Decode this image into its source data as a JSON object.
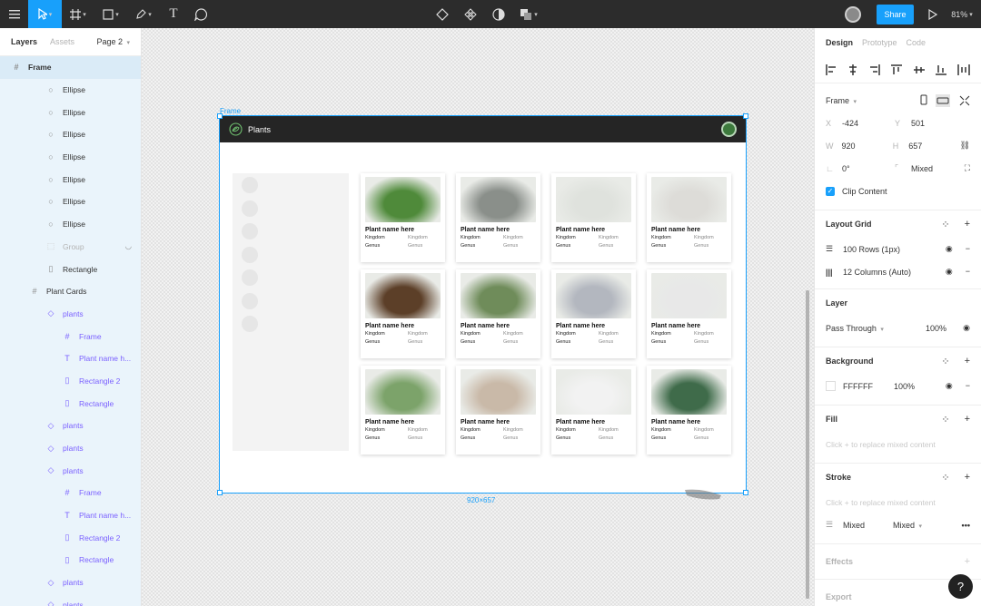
{
  "topbar": {
    "share_label": "Share",
    "zoom": "81%"
  },
  "left_panel": {
    "tabs": [
      "Layers",
      "Assets"
    ],
    "page": "Page 2",
    "layers": [
      {
        "label": "Frame",
        "icon": "frame-icon",
        "indent": 0,
        "kind": "selected"
      },
      {
        "label": "Ellipse",
        "icon": "ellipse-icon",
        "indent": 2,
        "kind": "sub"
      },
      {
        "label": "Ellipse",
        "icon": "ellipse-icon",
        "indent": 2,
        "kind": "sub"
      },
      {
        "label": "Ellipse",
        "icon": "ellipse-icon",
        "indent": 2,
        "kind": "sub"
      },
      {
        "label": "Ellipse",
        "icon": "ellipse-icon",
        "indent": 2,
        "kind": "sub"
      },
      {
        "label": "Ellipse",
        "icon": "ellipse-icon",
        "indent": 2,
        "kind": "sub"
      },
      {
        "label": "Ellipse",
        "icon": "ellipse-icon",
        "indent": 2,
        "kind": "sub"
      },
      {
        "label": "Ellipse",
        "icon": "ellipse-icon",
        "indent": 2,
        "kind": "sub"
      },
      {
        "label": "Group",
        "icon": "group-icon",
        "indent": 2,
        "kind": "hidden"
      },
      {
        "label": "Rectangle",
        "icon": "rectangle-icon",
        "indent": 2,
        "kind": "sub"
      },
      {
        "label": "Plant Cards",
        "icon": "frame-icon",
        "indent": 1,
        "kind": "sub"
      },
      {
        "label": "plants",
        "icon": "instance-icon",
        "indent": 2,
        "kind": "component"
      },
      {
        "label": "Frame",
        "icon": "frame-icon",
        "indent": 3,
        "kind": "component"
      },
      {
        "label": "Plant name h...",
        "icon": "text-icon",
        "indent": 3,
        "kind": "component"
      },
      {
        "label": "Rectangle 2",
        "icon": "rectangle-icon",
        "indent": 3,
        "kind": "component"
      },
      {
        "label": "Rectangle",
        "icon": "rectangle-icon",
        "indent": 3,
        "kind": "component"
      },
      {
        "label": "plants",
        "icon": "instance-icon",
        "indent": 2,
        "kind": "component"
      },
      {
        "label": "plants",
        "icon": "instance-icon",
        "indent": 2,
        "kind": "component"
      },
      {
        "label": "plants",
        "icon": "instance-icon",
        "indent": 2,
        "kind": "component"
      },
      {
        "label": "Frame",
        "icon": "frame-icon",
        "indent": 3,
        "kind": "component"
      },
      {
        "label": "Plant name h...",
        "icon": "text-icon",
        "indent": 3,
        "kind": "component"
      },
      {
        "label": "Rectangle 2",
        "icon": "rectangle-icon",
        "indent": 3,
        "kind": "component"
      },
      {
        "label": "Rectangle",
        "icon": "rectangle-icon",
        "indent": 3,
        "kind": "component"
      },
      {
        "label": "plants",
        "icon": "instance-icon",
        "indent": 2,
        "kind": "component"
      },
      {
        "label": "plants",
        "icon": "instance-icon",
        "indent": 2,
        "kind": "component"
      }
    ]
  },
  "canvas": {
    "frame_label": "Frame",
    "size_label": "920×657",
    "app_title": "Plants",
    "cards": [
      {
        "name": "Plant name here",
        "k1": "Kingdom",
        "k2": "Kingdom",
        "g1": "Genus",
        "g2": "Genus"
      },
      {
        "name": "Plant name here",
        "k1": "Kingdom",
        "k2": "Kingdom",
        "g1": "Genus",
        "g2": "Genus"
      },
      {
        "name": "Plant name here",
        "k1": "Kingdom",
        "k2": "Kingdom",
        "g1": "Genus",
        "g2": "Genus"
      },
      {
        "name": "Plant name here",
        "k1": "Kingdom",
        "k2": "Kingdom",
        "g1": "Genus",
        "g2": "Genus"
      },
      {
        "name": "Plant name here",
        "k1": "Kingdom",
        "k2": "Kingdom",
        "g1": "Genus",
        "g2": "Genus"
      },
      {
        "name": "Plant name here",
        "k1": "Kingdom",
        "k2": "Kingdom",
        "g1": "Genus",
        "g2": "Genus"
      },
      {
        "name": "Plant name here",
        "k1": "Kingdom",
        "k2": "Kingdom",
        "g1": "Genus",
        "g2": "Genus"
      },
      {
        "name": "Plant name here",
        "k1": "Kingdom",
        "k2": "Kingdom",
        "g1": "Genus",
        "g2": "Genus"
      },
      {
        "name": "Plant name here",
        "k1": "Kingdom",
        "k2": "Kingdom",
        "g1": "Genus",
        "g2": "Genus"
      },
      {
        "name": "Plant name here",
        "k1": "Kingdom",
        "k2": "Kingdom",
        "g1": "Genus",
        "g2": "Genus"
      },
      {
        "name": "Plant name here",
        "k1": "Kingdom",
        "k2": "Kingdom",
        "g1": "Genus",
        "g2": "Genus"
      },
      {
        "name": "Plant name here",
        "k1": "Kingdom",
        "k2": "Kingdom",
        "g1": "Genus",
        "g2": "Genus"
      }
    ],
    "card_image_colors": [
      "#4f8a3a",
      "#8a8f8a",
      "#dfe2dd",
      "#dddcd8",
      "#5c3f28",
      "#6f8c5a",
      "#b3b7bf",
      "#e8e8e8",
      "#7ca36a",
      "#c9b9a8",
      "#f2f2f2",
      "#3f6b4a"
    ]
  },
  "right_panel": {
    "tabs": [
      "Design",
      "Prototype",
      "Code"
    ],
    "frame_preset": "Frame",
    "x": "-424",
    "y": "501",
    "w": "920",
    "h": "657",
    "rotation": "0°",
    "radius": "Mixed",
    "clip_content": "Clip Content",
    "layout_grid": {
      "title": "Layout Grid",
      "grids": [
        "100 Rows (1px)",
        "12 Columns (Auto)"
      ]
    },
    "layer": {
      "title": "Layer",
      "blend": "Pass Through",
      "opacity": "100%"
    },
    "background": {
      "title": "Background",
      "hex": "FFFFFF",
      "opacity": "100%"
    },
    "fill": {
      "title": "Fill",
      "hint": "Click + to replace mixed content"
    },
    "stroke": {
      "title": "Stroke",
      "hint": "Click + to replace mixed content",
      "style": "Mixed",
      "weight": "Mixed"
    },
    "effects": {
      "title": "Effects"
    },
    "export": {
      "title": "Export"
    },
    "help": "?"
  }
}
